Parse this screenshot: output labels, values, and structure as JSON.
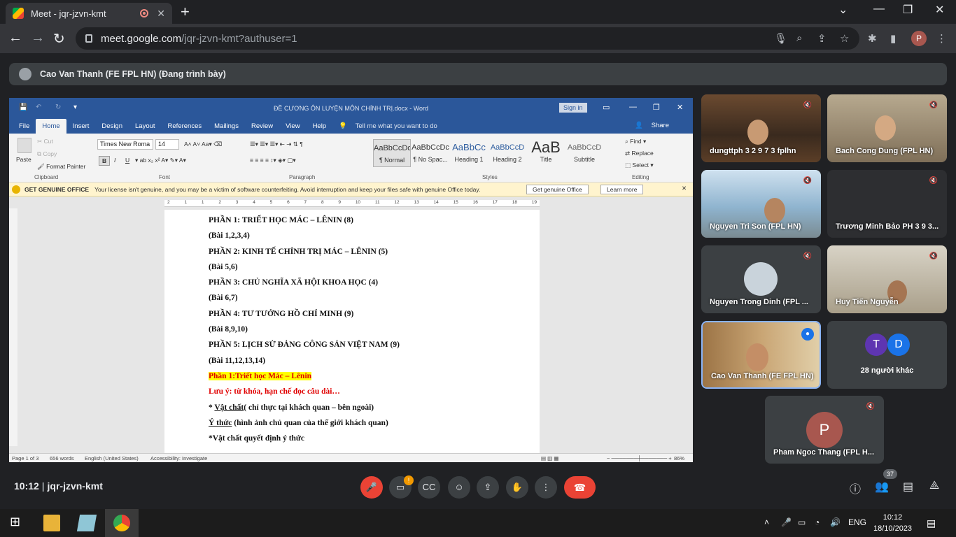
{
  "browser": {
    "tab_title": "Meet - jqr-jzvn-kmt",
    "tab_close": "✕",
    "new_tab": "+",
    "url_host": "meet.google.com",
    "url_path": "/jqr-jzvn-kmt?authuser=1",
    "profile_initial": "P"
  },
  "presenter": {
    "label": "Cao Van Thanh (FE FPL HN) (Đang trình bày)"
  },
  "word": {
    "doc_title": "ĐỀ CƯƠNG ÔN LUYỆN MÔN CHÍNH TRỊ.docx  -  Word",
    "sign_in": "Sign in",
    "tabs": [
      "File",
      "Home",
      "Insert",
      "Design",
      "Layout",
      "References",
      "Mailings",
      "Review",
      "View",
      "Help"
    ],
    "tell_me": "Tell me what you want to do",
    "share": "Share",
    "clipboard": {
      "paste": "Paste",
      "cut": "Cut",
      "copy": "Copy",
      "format_painter": "Format Painter",
      "label": "Clipboard"
    },
    "font": {
      "name": "Times New Roma",
      "size": "14",
      "label": "Font"
    },
    "paragraph_label": "Paragraph",
    "styles": [
      {
        "preview": "AaBbCcDc",
        "name": "¶ Normal"
      },
      {
        "preview": "AaBbCcDc",
        "name": "¶ No Spac..."
      },
      {
        "preview": "AaBbCc",
        "name": "Heading 1"
      },
      {
        "preview": "AaBbCcD",
        "name": "Heading 2"
      },
      {
        "preview": "AaB",
        "name": "Title"
      },
      {
        "preview": "AaBbCcD",
        "name": "Subtitle"
      }
    ],
    "styles_label": "Styles",
    "editing": {
      "find": "Find",
      "replace": "Replace",
      "select": "Select",
      "label": "Editing"
    },
    "genuine": {
      "title": "GET GENUINE OFFICE",
      "message": "Your license isn't genuine, and you may be a victim of software counterfeiting. Avoid interruption and keep your files safe with genuine Office today.",
      "btn_get": "Get genuine Office",
      "btn_learn": "Learn more"
    },
    "lines": [
      "PHẦN 1: TRIẾT HỌC MÁC – LÊNIN (8)",
      "(Bài 1,2,3,4)",
      "PHẦN 2: KINH TẾ CHÍNH TRỊ MÁC – LÊNIN (5)",
      "(Bài 5,6)",
      "PHẦN 3: CHỦ NGHĨA XÃ HỘI KHOA HỌC (4)",
      "(Bài 6,7)",
      "PHẦN 4: TƯ TƯỞNG HỒ CHÍ MINH (9)",
      "(Bài 8,9,10)",
      "PHẦN 5: LỊCH SỬ ĐẢNG CÔNG SẢN VIỆT NAM (9)",
      "(Bài 11,12,13,14)"
    ],
    "highlight_line": "Phần 1:Triết học Mác – Lênin",
    "note_line": "Lưu ý: từ khóa, hạn chế đọc câu dài…",
    "vatchat_prefix": "* ",
    "vatchat_u": "Vật chất",
    "vatchat_rest": "(  chỉ thực tại khách quan – bên ngoài)",
    "ythuc_u": "Ý thức",
    "ythuc_rest": " (hình ảnh chủ quan của thế giới khách quan)",
    "last_line": "*Vật chất quyết định ý thức",
    "status": {
      "page": "Page 1 of 3",
      "words": "656 words",
      "lang": "English (United States)",
      "access": "Accessibility: Investigate",
      "zoom": "86%"
    }
  },
  "participants": [
    {
      "name": "dungttph 3 2 9 7 3 fplhn"
    },
    {
      "name": "Bach Cong Dung (FPL HN)"
    },
    {
      "name": "Nguyen Tri Son (FPL HN)"
    },
    {
      "name": "Trương Minh Bảo PH 3 9 3..."
    },
    {
      "name": "Nguyen Trong Dinh (FPL ..."
    },
    {
      "name": "Huy Tiến Nguyễn"
    },
    {
      "name": "Cao Van Thanh (FE FPL HN)"
    },
    {
      "name": "Pham Ngoc Thang (FPL H...",
      "initial": "P"
    }
  ],
  "others": {
    "label": "28 người khác",
    "initials": [
      "T",
      "D"
    ]
  },
  "meeting": {
    "time": "10:12",
    "separator": "|",
    "code": "jqr-jzvn-kmt",
    "people_count": "37",
    "warn_mark": "!"
  },
  "taskbar": {
    "lang": "ENG",
    "clock_time": "10:12",
    "clock_date": "18/10/2023"
  },
  "colors": {
    "word_blue": "#2b579a",
    "meet_red": "#ea4335",
    "highlight": "#ffff00"
  }
}
